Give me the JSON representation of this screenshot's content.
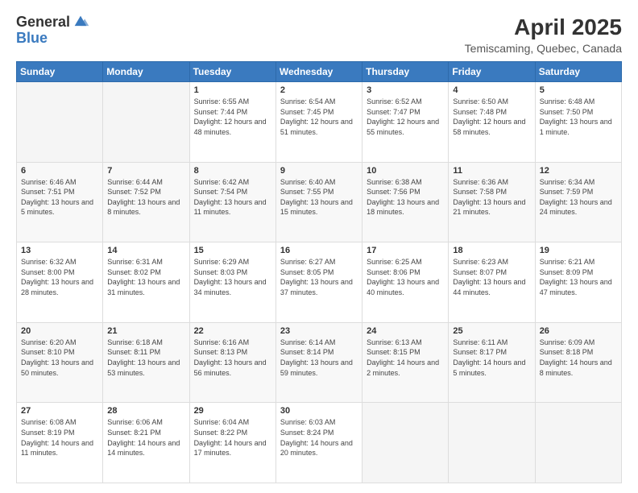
{
  "logo": {
    "general": "General",
    "blue": "Blue"
  },
  "header": {
    "title": "April 2025",
    "subtitle": "Temiscaming, Quebec, Canada"
  },
  "weekdays": [
    "Sunday",
    "Monday",
    "Tuesday",
    "Wednesday",
    "Thursday",
    "Friday",
    "Saturday"
  ],
  "weeks": [
    [
      null,
      null,
      {
        "day": "1",
        "sunrise": "Sunrise: 6:55 AM",
        "sunset": "Sunset: 7:44 PM",
        "daylight": "Daylight: 12 hours and 48 minutes."
      },
      {
        "day": "2",
        "sunrise": "Sunrise: 6:54 AM",
        "sunset": "Sunset: 7:45 PM",
        "daylight": "Daylight: 12 hours and 51 minutes."
      },
      {
        "day": "3",
        "sunrise": "Sunrise: 6:52 AM",
        "sunset": "Sunset: 7:47 PM",
        "daylight": "Daylight: 12 hours and 55 minutes."
      },
      {
        "day": "4",
        "sunrise": "Sunrise: 6:50 AM",
        "sunset": "Sunset: 7:48 PM",
        "daylight": "Daylight: 12 hours and 58 minutes."
      },
      {
        "day": "5",
        "sunrise": "Sunrise: 6:48 AM",
        "sunset": "Sunset: 7:50 PM",
        "daylight": "Daylight: 13 hours and 1 minute."
      }
    ],
    [
      {
        "day": "6",
        "sunrise": "Sunrise: 6:46 AM",
        "sunset": "Sunset: 7:51 PM",
        "daylight": "Daylight: 13 hours and 5 minutes."
      },
      {
        "day": "7",
        "sunrise": "Sunrise: 6:44 AM",
        "sunset": "Sunset: 7:52 PM",
        "daylight": "Daylight: 13 hours and 8 minutes."
      },
      {
        "day": "8",
        "sunrise": "Sunrise: 6:42 AM",
        "sunset": "Sunset: 7:54 PM",
        "daylight": "Daylight: 13 hours and 11 minutes."
      },
      {
        "day": "9",
        "sunrise": "Sunrise: 6:40 AM",
        "sunset": "Sunset: 7:55 PM",
        "daylight": "Daylight: 13 hours and 15 minutes."
      },
      {
        "day": "10",
        "sunrise": "Sunrise: 6:38 AM",
        "sunset": "Sunset: 7:56 PM",
        "daylight": "Daylight: 13 hours and 18 minutes."
      },
      {
        "day": "11",
        "sunrise": "Sunrise: 6:36 AM",
        "sunset": "Sunset: 7:58 PM",
        "daylight": "Daylight: 13 hours and 21 minutes."
      },
      {
        "day": "12",
        "sunrise": "Sunrise: 6:34 AM",
        "sunset": "Sunset: 7:59 PM",
        "daylight": "Daylight: 13 hours and 24 minutes."
      }
    ],
    [
      {
        "day": "13",
        "sunrise": "Sunrise: 6:32 AM",
        "sunset": "Sunset: 8:00 PM",
        "daylight": "Daylight: 13 hours and 28 minutes."
      },
      {
        "day": "14",
        "sunrise": "Sunrise: 6:31 AM",
        "sunset": "Sunset: 8:02 PM",
        "daylight": "Daylight: 13 hours and 31 minutes."
      },
      {
        "day": "15",
        "sunrise": "Sunrise: 6:29 AM",
        "sunset": "Sunset: 8:03 PM",
        "daylight": "Daylight: 13 hours and 34 minutes."
      },
      {
        "day": "16",
        "sunrise": "Sunrise: 6:27 AM",
        "sunset": "Sunset: 8:05 PM",
        "daylight": "Daylight: 13 hours and 37 minutes."
      },
      {
        "day": "17",
        "sunrise": "Sunrise: 6:25 AM",
        "sunset": "Sunset: 8:06 PM",
        "daylight": "Daylight: 13 hours and 40 minutes."
      },
      {
        "day": "18",
        "sunrise": "Sunrise: 6:23 AM",
        "sunset": "Sunset: 8:07 PM",
        "daylight": "Daylight: 13 hours and 44 minutes."
      },
      {
        "day": "19",
        "sunrise": "Sunrise: 6:21 AM",
        "sunset": "Sunset: 8:09 PM",
        "daylight": "Daylight: 13 hours and 47 minutes."
      }
    ],
    [
      {
        "day": "20",
        "sunrise": "Sunrise: 6:20 AM",
        "sunset": "Sunset: 8:10 PM",
        "daylight": "Daylight: 13 hours and 50 minutes."
      },
      {
        "day": "21",
        "sunrise": "Sunrise: 6:18 AM",
        "sunset": "Sunset: 8:11 PM",
        "daylight": "Daylight: 13 hours and 53 minutes."
      },
      {
        "day": "22",
        "sunrise": "Sunrise: 6:16 AM",
        "sunset": "Sunset: 8:13 PM",
        "daylight": "Daylight: 13 hours and 56 minutes."
      },
      {
        "day": "23",
        "sunrise": "Sunrise: 6:14 AM",
        "sunset": "Sunset: 8:14 PM",
        "daylight": "Daylight: 13 hours and 59 minutes."
      },
      {
        "day": "24",
        "sunrise": "Sunrise: 6:13 AM",
        "sunset": "Sunset: 8:15 PM",
        "daylight": "Daylight: 14 hours and 2 minutes."
      },
      {
        "day": "25",
        "sunrise": "Sunrise: 6:11 AM",
        "sunset": "Sunset: 8:17 PM",
        "daylight": "Daylight: 14 hours and 5 minutes."
      },
      {
        "day": "26",
        "sunrise": "Sunrise: 6:09 AM",
        "sunset": "Sunset: 8:18 PM",
        "daylight": "Daylight: 14 hours and 8 minutes."
      }
    ],
    [
      {
        "day": "27",
        "sunrise": "Sunrise: 6:08 AM",
        "sunset": "Sunset: 8:19 PM",
        "daylight": "Daylight: 14 hours and 11 minutes."
      },
      {
        "day": "28",
        "sunrise": "Sunrise: 6:06 AM",
        "sunset": "Sunset: 8:21 PM",
        "daylight": "Daylight: 14 hours and 14 minutes."
      },
      {
        "day": "29",
        "sunrise": "Sunrise: 6:04 AM",
        "sunset": "Sunset: 8:22 PM",
        "daylight": "Daylight: 14 hours and 17 minutes."
      },
      {
        "day": "30",
        "sunrise": "Sunrise: 6:03 AM",
        "sunset": "Sunset: 8:24 PM",
        "daylight": "Daylight: 14 hours and 20 minutes."
      },
      null,
      null,
      null
    ]
  ]
}
